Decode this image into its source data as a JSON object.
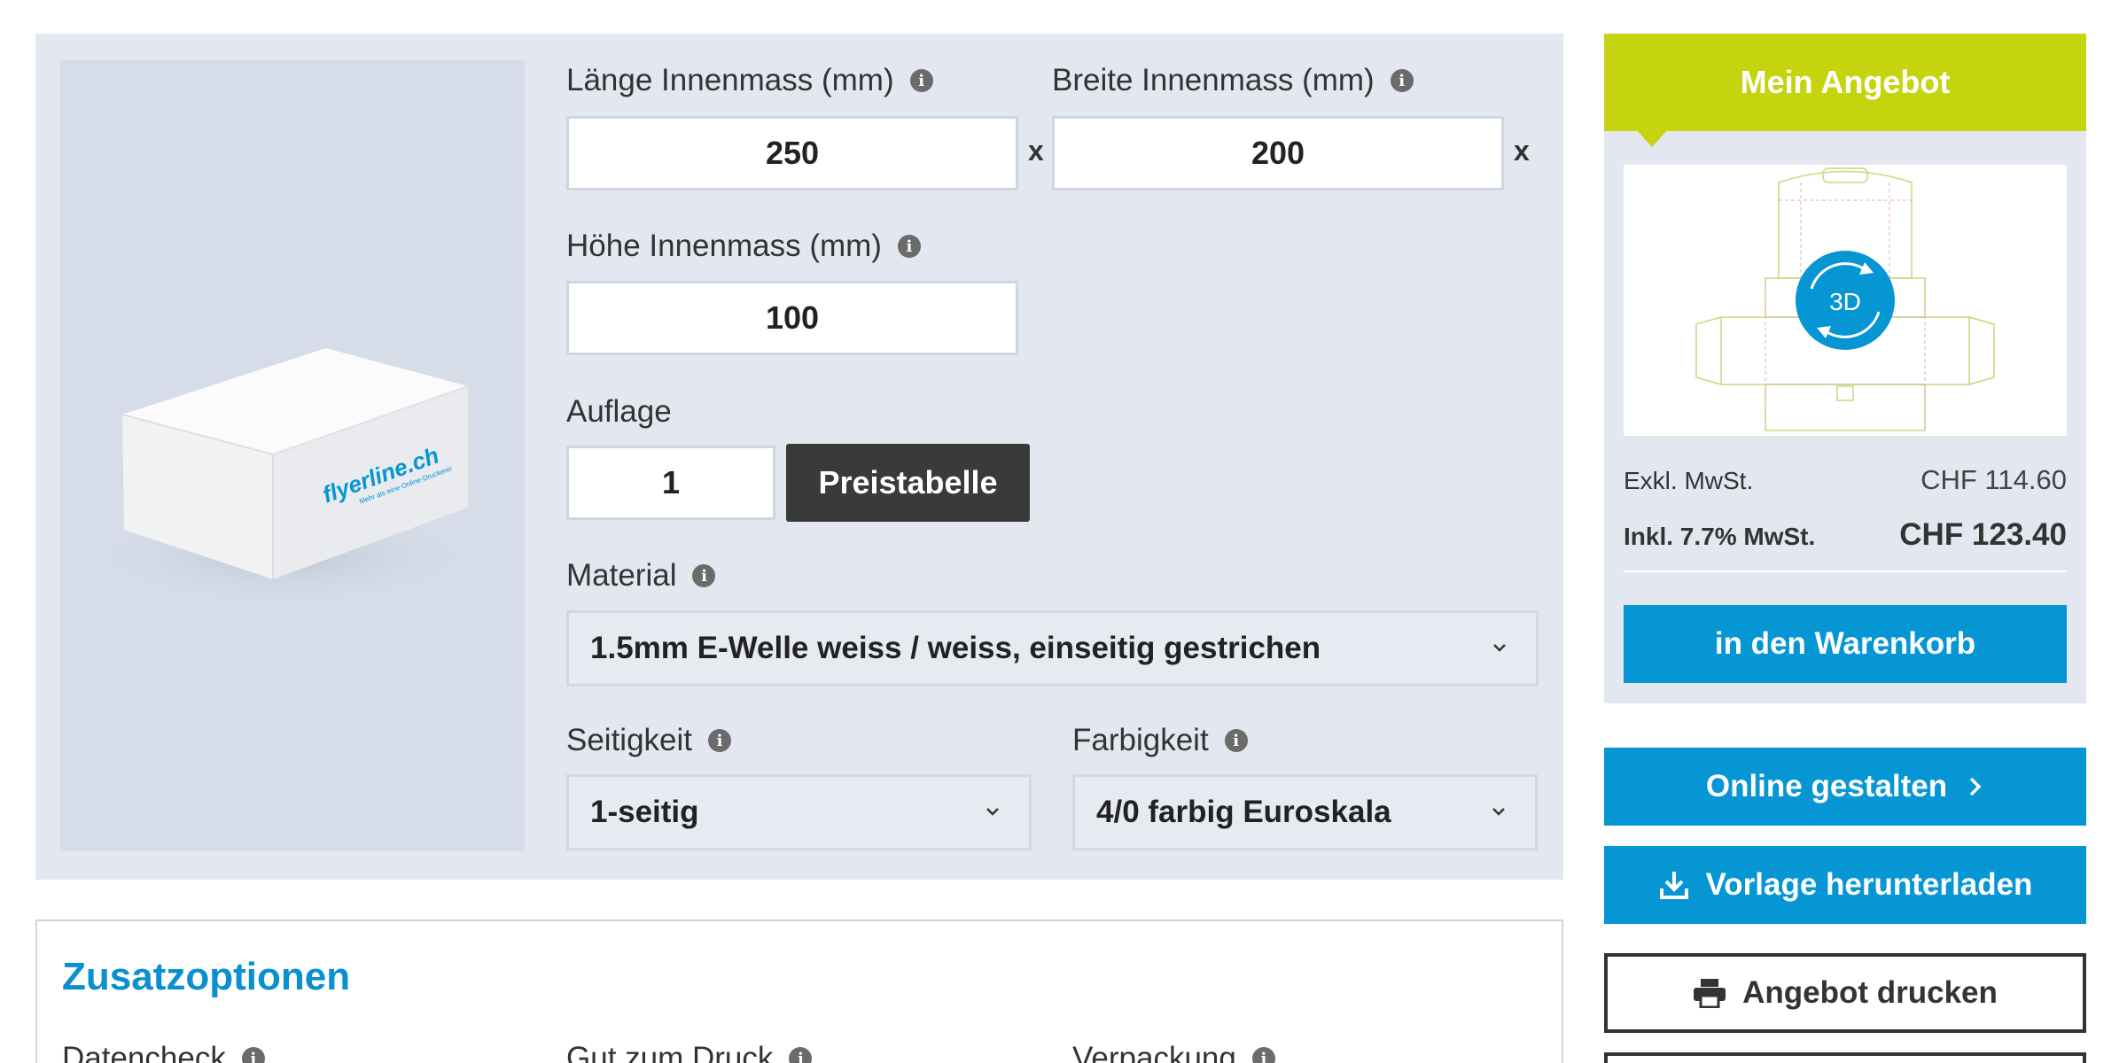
{
  "configurator": {
    "length": {
      "label": "Länge Innenmass (mm)",
      "value": "250"
    },
    "width": {
      "label": "Breite Innenmass (mm)",
      "value": "200"
    },
    "height": {
      "label": "Höhe Innenmass (mm)",
      "value": "100"
    },
    "times_symbol": "x",
    "quantity": {
      "label": "Auflage",
      "value": "1"
    },
    "price_table_button": "Preistabelle",
    "material": {
      "label": "Material",
      "value": "1.5mm E-Welle weiss / weiss, einseitig gestrichen"
    },
    "sides": {
      "label": "Seitigkeit",
      "value": "1-seitig"
    },
    "colors": {
      "label": "Farbigkeit",
      "value": "4/0 farbig Euroskala"
    },
    "info_icon_glyph": "i",
    "product_image": {
      "brand": "flyerline.ch",
      "tagline": "Mehr als eine Online-Druckerei"
    }
  },
  "extras": {
    "title": "Zusatzoptionen",
    "options": [
      "Datencheck",
      "Gut zum Druck",
      "Verpackung"
    ]
  },
  "offer": {
    "title": "Mein Angebot",
    "preview_badge": "3D",
    "excl_label": "Exkl. MwSt.",
    "excl_price": "CHF 114.60",
    "incl_label": "Inkl. 7.7% MwSt.",
    "incl_price": "CHF 123.40",
    "cart_button": "in den Warenkorb"
  },
  "actions": {
    "design_online": "Online gestalten",
    "download_template": "Vorlage herunterladen",
    "print_offer": "Angebot drucken"
  },
  "colors": {
    "accent_blue": "#0596d3",
    "lime": "#c6d40f",
    "panel_bg": "#e2e7f0",
    "dark_button": "#3a3a3a"
  },
  "icons": [
    "info-icon",
    "chevron-down-icon",
    "chevron-right-icon",
    "download-icon",
    "printer-icon",
    "rotate-3d-icon"
  ]
}
